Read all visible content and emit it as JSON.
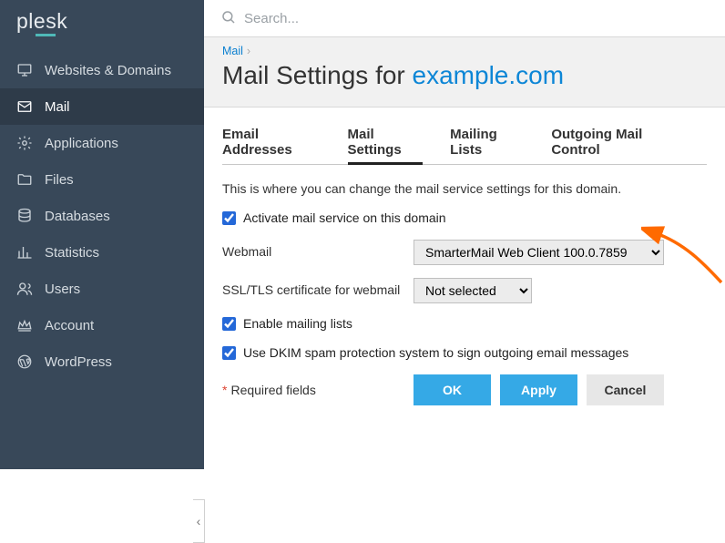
{
  "brand": "plesk",
  "search": {
    "placeholder": "Search..."
  },
  "sidebar": {
    "items": [
      {
        "label": "Websites & Domains",
        "icon": "monitor"
      },
      {
        "label": "Mail",
        "icon": "envelope",
        "active": true
      },
      {
        "label": "Applications",
        "icon": "gear"
      },
      {
        "label": "Files",
        "icon": "folder"
      },
      {
        "label": "Databases",
        "icon": "stack"
      },
      {
        "label": "Statistics",
        "icon": "bars"
      },
      {
        "label": "Users",
        "icon": "users"
      },
      {
        "label": "Account",
        "icon": "crown"
      },
      {
        "label": "WordPress",
        "icon": "wp"
      }
    ]
  },
  "breadcrumb": {
    "root": "Mail"
  },
  "title": {
    "prefix": "Mail Settings for ",
    "domain": "example.com"
  },
  "tabs": [
    {
      "label": "Email Addresses"
    },
    {
      "label": "Mail Settings",
      "active": true
    },
    {
      "label": "Mailing Lists"
    },
    {
      "label": "Outgoing Mail Control"
    }
  ],
  "intro": "This is where you can change the mail service settings for this domain.",
  "form": {
    "activate_label": "Activate mail service on this domain",
    "activate_checked": true,
    "webmail_label": "Webmail",
    "webmail_value": "SmarterMail Web Client 100.0.7859",
    "ssl_label": "SSL/TLS certificate for webmail",
    "ssl_value": "Not selected",
    "mailing_label": "Enable mailing lists",
    "mailing_checked": true,
    "dkim_label": "Use DKIM spam protection system to sign outgoing email messages",
    "dkim_checked": true
  },
  "footer": {
    "required_note": "Required fields",
    "ok": "OK",
    "apply": "Apply",
    "cancel": "Cancel"
  }
}
